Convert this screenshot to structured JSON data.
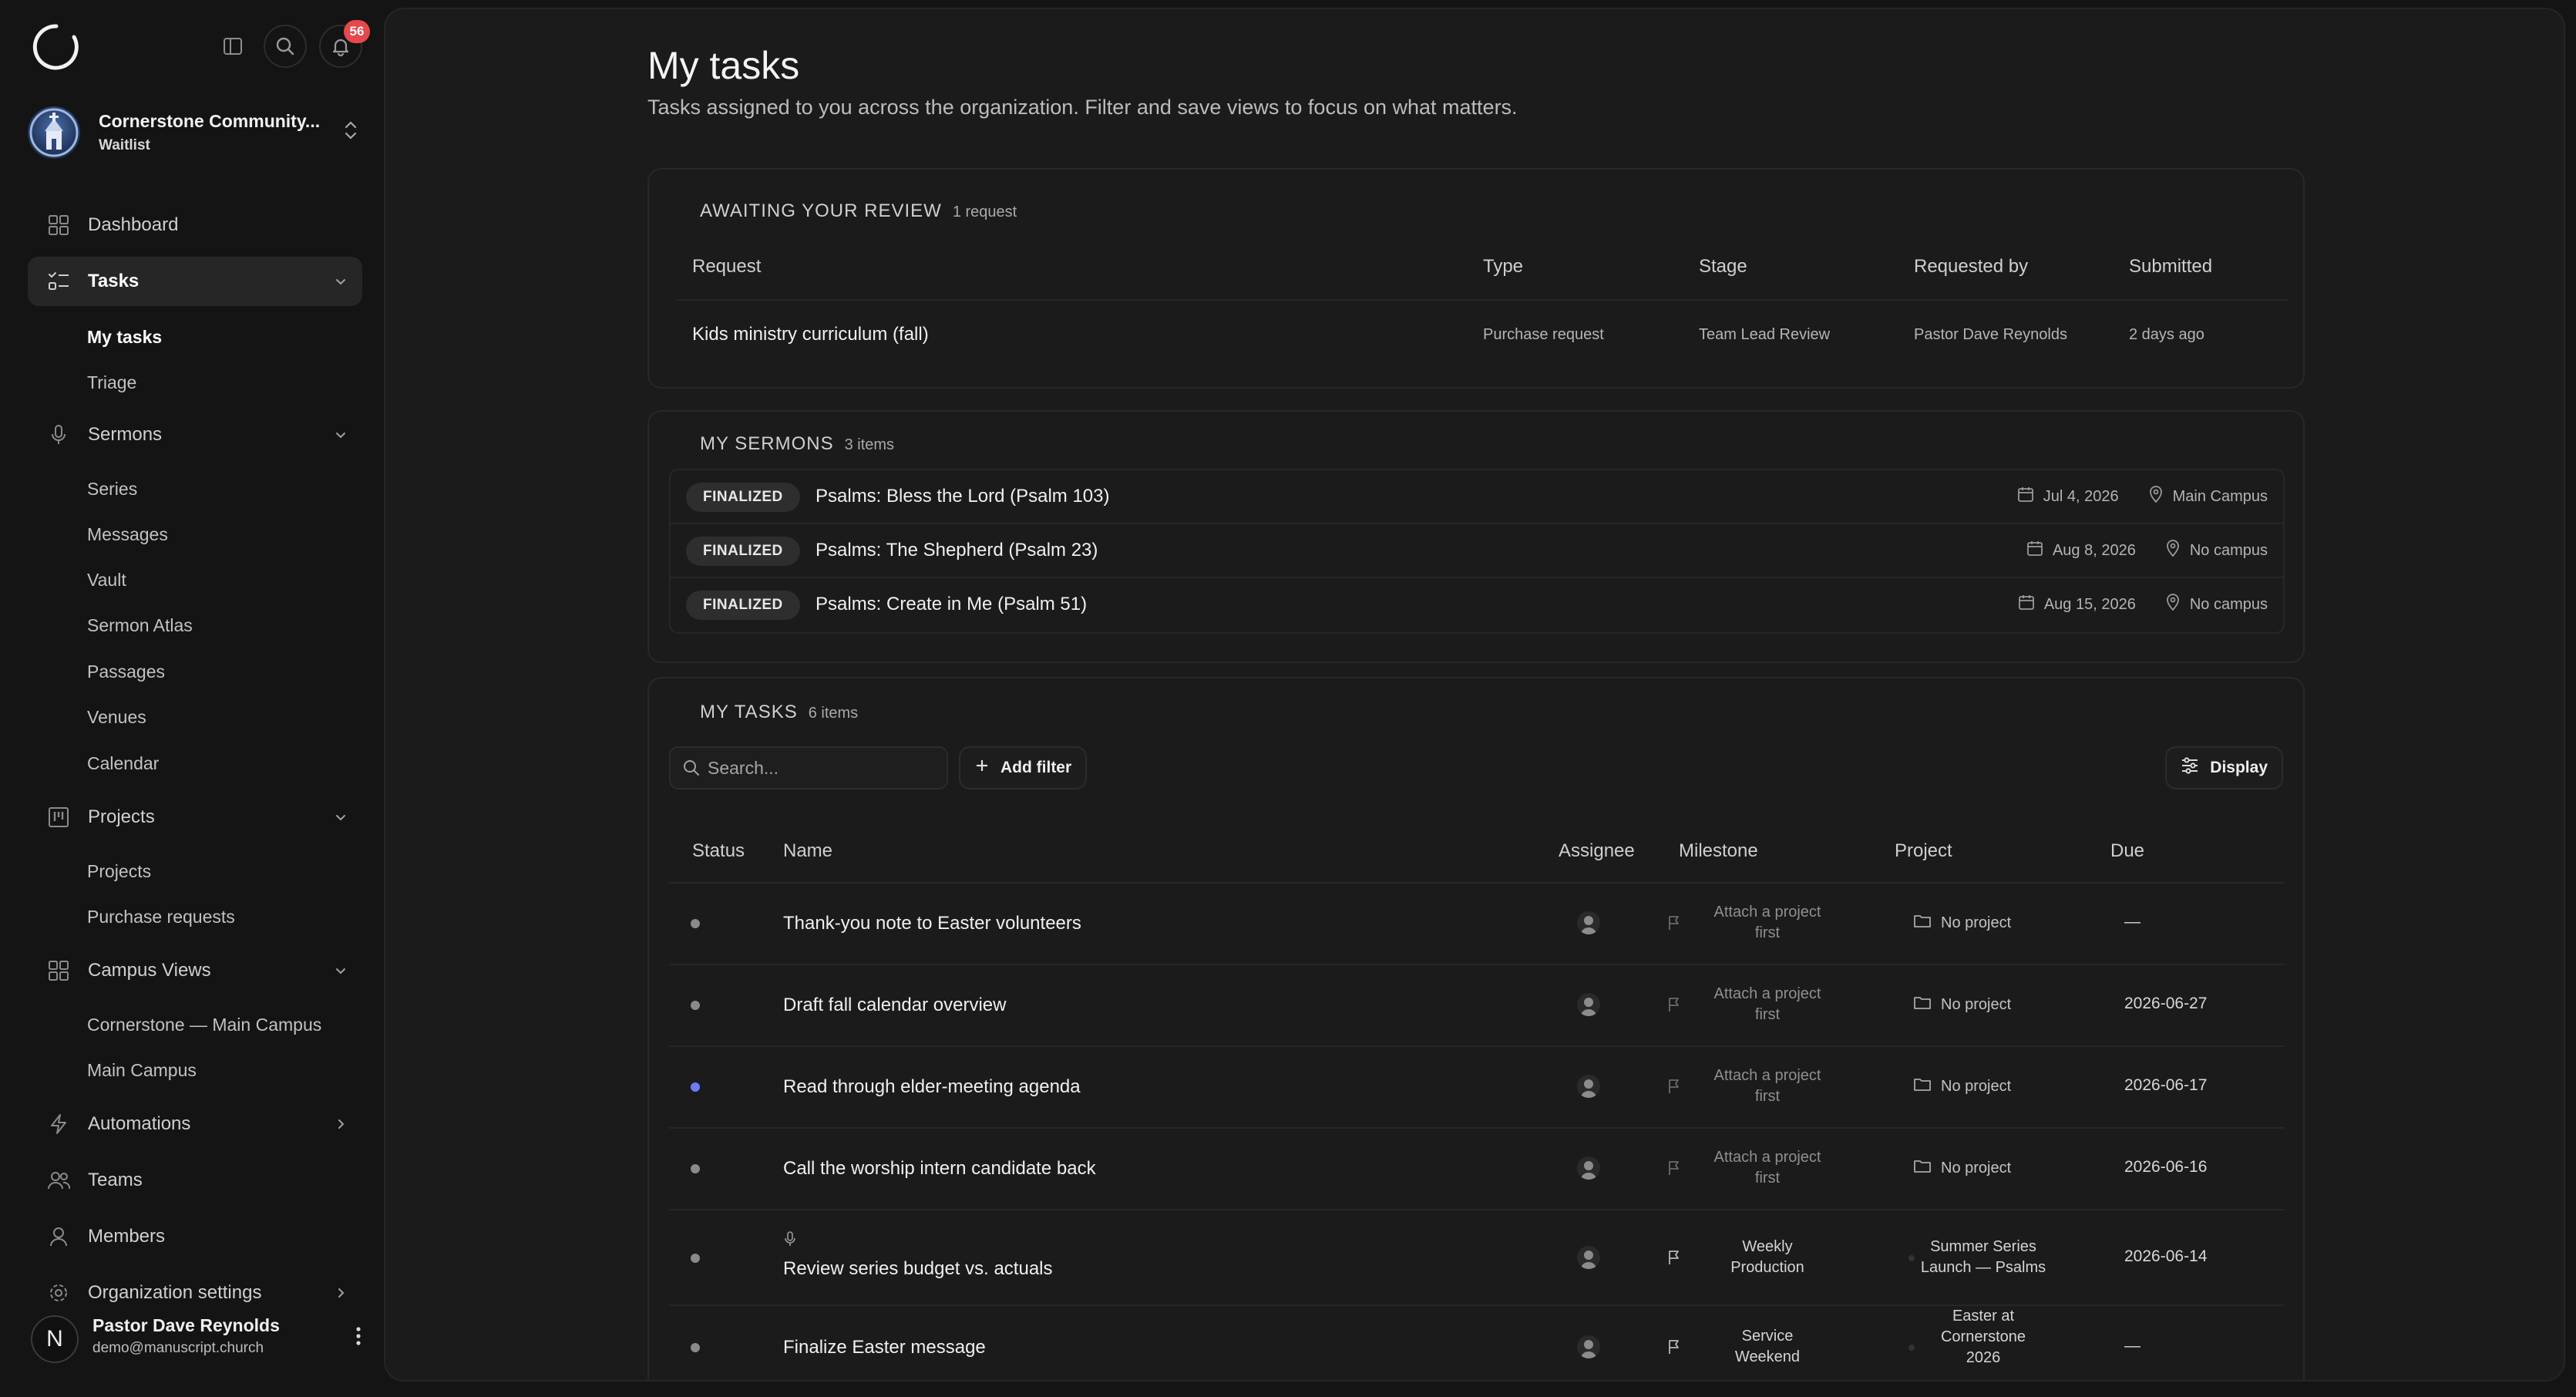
{
  "notifications": {
    "count": "56"
  },
  "org": {
    "name": "Cornerstone Community...",
    "status": "Waitlist"
  },
  "nav": {
    "dashboard": "Dashboard",
    "tasks": "Tasks",
    "tasks_sub": [
      "My tasks",
      "Triage"
    ],
    "sermons": "Sermons",
    "sermons_sub": [
      "Series",
      "Messages",
      "Vault",
      "Sermon Atlas",
      "Passages",
      "Venues",
      "Calendar"
    ],
    "projects": "Projects",
    "projects_sub": [
      "Projects",
      "Purchase requests"
    ],
    "campus_views": "Campus Views",
    "campus_sub": [
      "Cornerstone — Main Campus",
      "Main Campus"
    ],
    "automations": "Automations",
    "teams": "Teams",
    "members": "Members",
    "org_settings": "Organization settings"
  },
  "user": {
    "name": "Pastor Dave Reynolds",
    "email": "demo@manuscript.church",
    "initial": "N"
  },
  "page": {
    "title": "My tasks",
    "subtitle": "Tasks assigned to you across the organization. Filter and save views to focus on what matters."
  },
  "review": {
    "title": "AWAITING YOUR REVIEW",
    "count": "1 request",
    "headers": {
      "request": "Request",
      "type": "Type",
      "stage": "Stage",
      "requested_by": "Requested by",
      "submitted": "Submitted"
    },
    "rows": [
      {
        "request": "Kids ministry curriculum (fall)",
        "type": "Purchase request",
        "stage": "Team Lead Review",
        "requested_by": "Pastor Dave Reynolds",
        "submitted": "2 days ago"
      }
    ]
  },
  "sermons": {
    "title": "MY SERMONS",
    "count": "3 items",
    "rows": [
      {
        "status": "FINALIZED",
        "title": "Psalms: Bless the Lord (Psalm 103)",
        "date": "Jul 4, 2026",
        "campus": "Main Campus"
      },
      {
        "status": "FINALIZED",
        "title": "Psalms: The Shepherd (Psalm 23)",
        "date": "Aug 8, 2026",
        "campus": "No campus"
      },
      {
        "status": "FINALIZED",
        "title": "Psalms: Create in Me (Psalm 51)",
        "date": "Aug 15, 2026",
        "campus": "No campus"
      }
    ]
  },
  "tasks": {
    "title": "MY TASKS",
    "count": "6 items",
    "search_placeholder": "Search...",
    "add_filter": "Add filter",
    "display": "Display",
    "headers": {
      "status": "Status",
      "name": "Name",
      "assignee": "Assignee",
      "milestone": "Milestone",
      "project": "Project",
      "due": "Due"
    },
    "rows": [
      {
        "status": "todo",
        "name": "Thank-you note to Easter volunteers",
        "milestone_l1": "Attach a project",
        "milestone_l2": "first",
        "project": "No project",
        "due": "—"
      },
      {
        "status": "todo",
        "name": "Draft fall calendar overview",
        "milestone_l1": "Attach a project",
        "milestone_l2": "first",
        "project": "No project",
        "due": "2026-06-27"
      },
      {
        "status": "in-progress",
        "name": "Read through elder-meeting agenda",
        "milestone_l1": "Attach a project",
        "milestone_l2": "first",
        "project": "No project",
        "due": "2026-06-17"
      },
      {
        "status": "todo",
        "name": "Call the worship intern candidate back",
        "milestone_l1": "Attach a project",
        "milestone_l2": "first",
        "project": "No project",
        "due": "2026-06-16"
      },
      {
        "status": "todo",
        "name": "Review series budget vs. actuals",
        "milestone_l1": "Weekly",
        "milestone_l2": "Production",
        "project_l1": "Summer Series",
        "project_l2": "Launch — Psalms",
        "due": "2026-06-14"
      },
      {
        "status": "todo",
        "name": "Finalize Easter message",
        "milestone_l1": "Service",
        "milestone_l2": "Weekend",
        "project_l1": "Easter at",
        "project_l2": "Cornerstone",
        "project_l3": "2026",
        "due": "—"
      }
    ]
  },
  "colors": {
    "background": "#141414",
    "panel": "#1b1b1b",
    "accent_blue": "#6b7cff",
    "badge_red": "#e5484d"
  }
}
